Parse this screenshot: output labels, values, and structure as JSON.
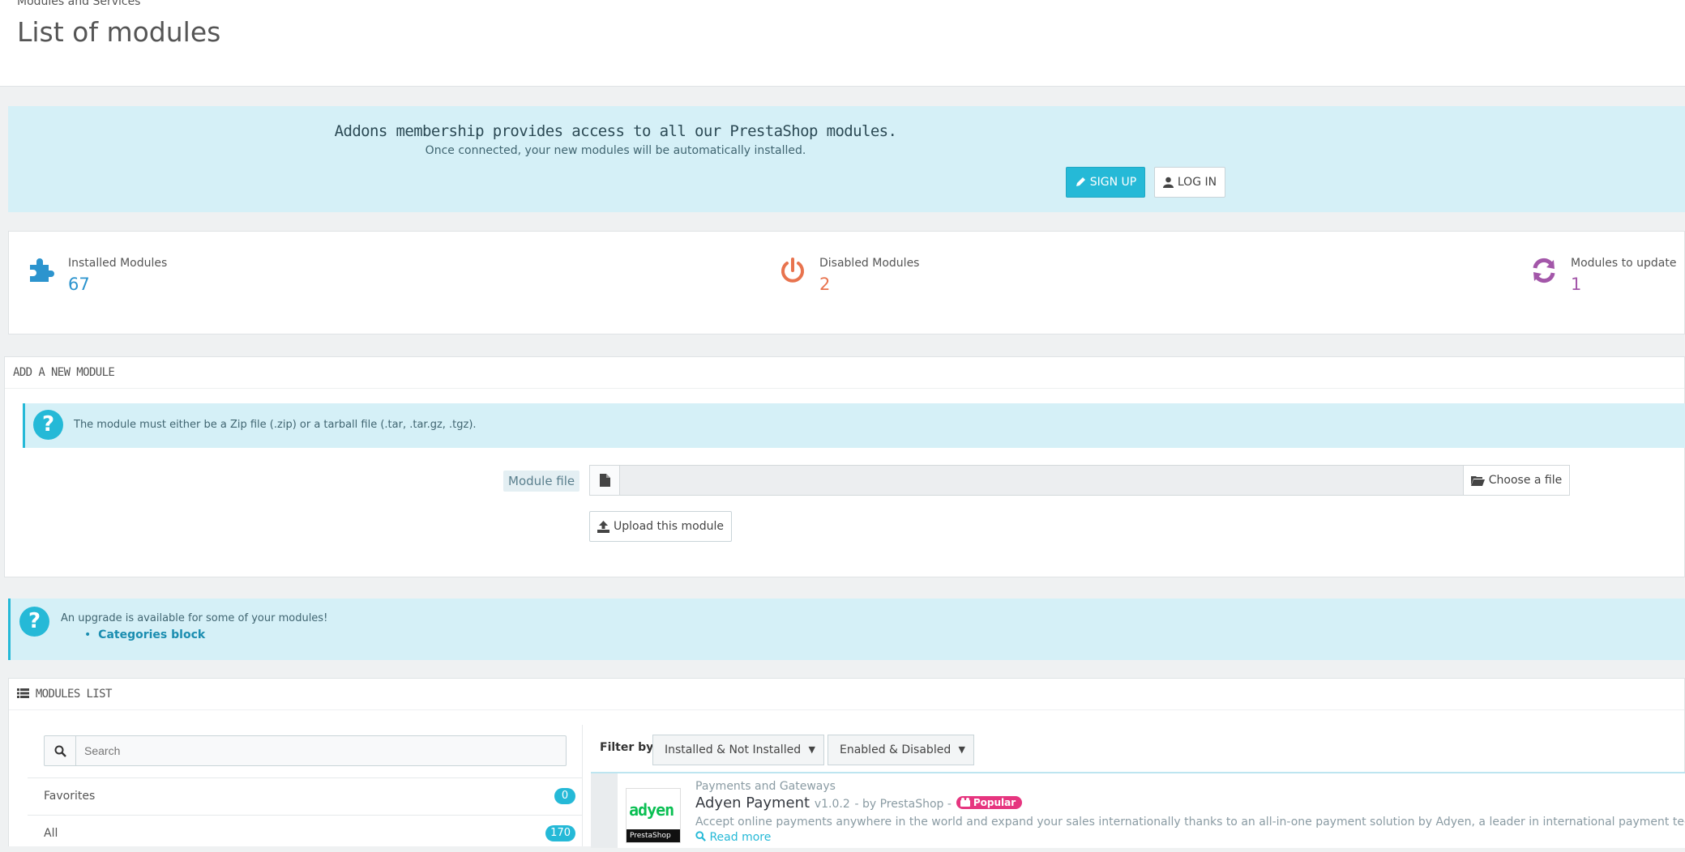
{
  "header": {
    "breadcrumb": "Modules and Services",
    "title": "List of modules"
  },
  "addons": {
    "title": "Addons membership provides access to all our PrestaShop modules.",
    "subtitle": "Once connected, your new modules will be automatically installed.",
    "signup_label": "SIGN UP",
    "login_label": "LOG IN"
  },
  "stats": {
    "installed": {
      "label": "Installed Modules",
      "value": "67",
      "color": "#2c94ce"
    },
    "disabled": {
      "label": "Disabled Modules",
      "value": "2",
      "color": "#e8734e"
    },
    "update": {
      "label": "Modules to update",
      "value": "1",
      "color": "#a357a9"
    }
  },
  "add_module": {
    "heading": "ADD A NEW MODULE",
    "info": "The module must either be a Zip file (.zip) or a tarball file (.tar, .tar.gz, .tgz).",
    "file_label": "Module file",
    "choose_label": "Choose a file",
    "upload_label": "Upload this module"
  },
  "upgrade": {
    "text": "An upgrade is available for some of your modules!",
    "items": [
      "Categories block"
    ]
  },
  "modules_list": {
    "heading": "MODULES LIST",
    "search_placeholder": "Search",
    "categories": [
      {
        "label": "Favorites",
        "count": "0"
      },
      {
        "label": "All",
        "count": "170"
      }
    ],
    "filter_label": "Filter by",
    "filter_install": "Installed & Not Installed",
    "filter_enabled": "Enabled & Disabled",
    "module": {
      "category": "Payments and Gateways",
      "name": "Adyen Payment",
      "version": "v1.0.2",
      "author_prefix": "- by PrestaShop -",
      "badge": "Popular",
      "logo_text": "adyen",
      "logo_sub": "PrestaShop",
      "description": "Accept online payments anywhere in the world and expand your sales internationally thanks to an all-in-one payment solution by Adyen, a leader in international payment technology.",
      "read_more": "Read more"
    }
  }
}
